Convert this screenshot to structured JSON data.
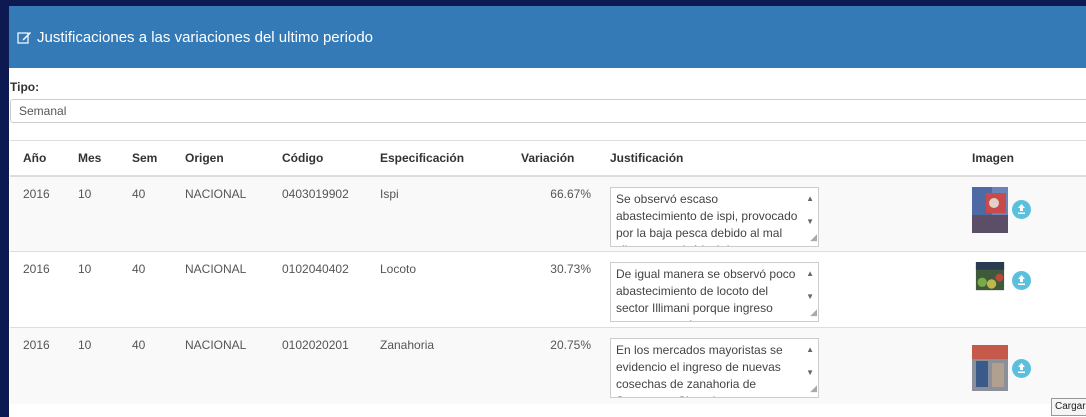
{
  "panel": {
    "title": "Justificaciones a las variaciones del ultimo periodo",
    "title_icon": "edit-icon"
  },
  "tipo": {
    "label": "Tipo:",
    "selected": "Semanal"
  },
  "table": {
    "headers": [
      "Año",
      "Mes",
      "Sem",
      "Origen",
      "Código",
      "Especificación",
      "Variación",
      "Justificación",
      "Imagen"
    ],
    "rows": [
      {
        "anio": "2016",
        "mes": "10",
        "sem": "40",
        "origen": "NACIONAL",
        "codigo": "0403019902",
        "especificacion": "Ispi",
        "variacion": "66.67%",
        "justificacion": "Se observó escaso abastecimiento de ispi, provocado por la baja pesca  debido al mal clima, se cotizó ispi de Copacabana."
      },
      {
        "anio": "2016",
        "mes": "10",
        "sem": "40",
        "origen": "NACIONAL",
        "codigo": "0102040402",
        "especificacion": "Locoto",
        "variacion": "30.73%",
        "justificacion": "De igual manera se observó poco abastecimiento de locoto del sector Illimani porque ingreso nuevas cosechas."
      },
      {
        "anio": "2016",
        "mes": "10",
        "sem": "40",
        "origen": "NACIONAL",
        "codigo": "0102020201",
        "especificacion": "Zanahoria",
        "variacion": "20.75%",
        "justificacion": "En los mercados mayoristas  se evidencio el ingreso de nuevas cosechas de zanahoria de Sotomayor Chuquisaca."
      }
    ]
  },
  "tooltip": "Cargar",
  "colors": {
    "header_bg": "#337ab7",
    "upload_button": "#5bc0de",
    "frame": "#0d1a52"
  }
}
